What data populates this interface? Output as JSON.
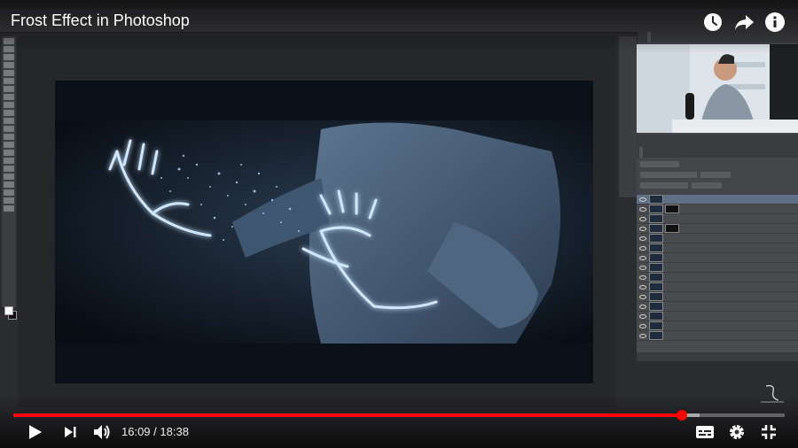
{
  "video": {
    "title": "Frost Effect in Photoshop",
    "current_time": "16:09",
    "separator": " / ",
    "duration": "18:38",
    "progress": 0.8667,
    "buffered": 0.8894
  },
  "icons": {
    "watch_later": "clock-icon",
    "share": "share-icon",
    "info": "info-icon",
    "play": "play-icon",
    "next": "next-icon",
    "volume": "volume-icon",
    "subtitles": "subtitles-icon",
    "settings": "gear-icon",
    "exit_fullscreen": "exit-fullscreen-icon"
  },
  "colors": {
    "progress_red": "#ff0000",
    "frost_glow": "#cfe8ff"
  }
}
